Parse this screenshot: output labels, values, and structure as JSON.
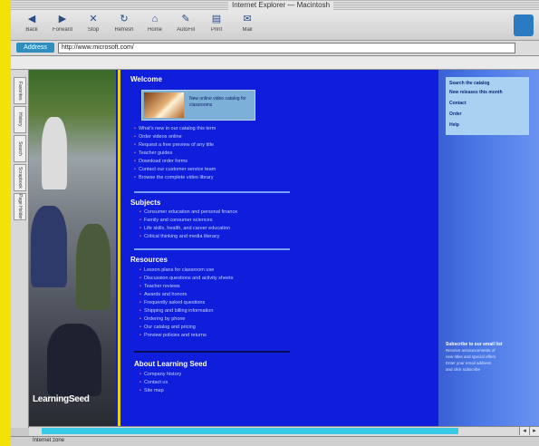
{
  "window": {
    "title": "Internet Explorer — Macintosh"
  },
  "toolbar": {
    "buttons": [
      {
        "label": "Back",
        "icon": "back-arrow-icon",
        "glyph": "◀"
      },
      {
        "label": "Forward",
        "icon": "forward-arrow-icon",
        "glyph": "▶"
      },
      {
        "label": "Stop",
        "icon": "stop-icon",
        "glyph": "✕"
      },
      {
        "label": "Refresh",
        "icon": "refresh-icon",
        "glyph": "↻"
      },
      {
        "label": "Home",
        "icon": "home-icon",
        "glyph": "⌂"
      },
      {
        "label": "AutoFill",
        "icon": "autofill-icon",
        "glyph": "✎"
      },
      {
        "label": "Print",
        "icon": "print-icon",
        "glyph": "▤"
      },
      {
        "label": "Mail",
        "icon": "mail-icon",
        "glyph": "✉"
      }
    ]
  },
  "location": {
    "label": "Address",
    "url": "http://www.microsoft.com/"
  },
  "sidebar_tabs": [
    "Favorites",
    "History",
    "Search",
    "Scrapbook",
    "Page Holder"
  ],
  "page": {
    "brand": "LearningSeed",
    "feature_text": "New online video catalog for classrooms",
    "sections": [
      {
        "title": "Welcome",
        "items": [
          "What's new in our catalog this term",
          "Order videos online",
          "Request a free preview of any title",
          "Teacher guides",
          "Download order forms",
          "Contact our customer service team",
          "Browse the complete video library"
        ]
      },
      {
        "title": "Subjects",
        "items": [
          "Consumer education and personal finance",
          "Family and consumer sciences",
          "Life skills, health, and career education",
          "Critical thinking and media literacy"
        ]
      },
      {
        "title": "Resources",
        "items": [
          "Lesson plans for classroom use",
          "Discussion questions and activity sheets",
          "Teacher reviews",
          "Awards and honors",
          "Frequently asked questions",
          "Shipping and billing information",
          "Ordering by phone",
          "Our catalog and pricing",
          "Preview policies and returns"
        ]
      },
      {
        "title": "About Learning Seed",
        "items": [
          "Company history",
          "Contact us",
          "Site map"
        ]
      }
    ],
    "right_panel_links": [
      "Search the catalog",
      "New releases this month",
      "Contact",
      "Order",
      "Help"
    ],
    "right_bottom": {
      "title": "Subscribe to our email list",
      "lines": [
        "Receive announcements of",
        "new titles and special offers",
        "Enter your email address",
        "and click subscribe"
      ]
    }
  },
  "status": {
    "text": "Internet zone"
  }
}
